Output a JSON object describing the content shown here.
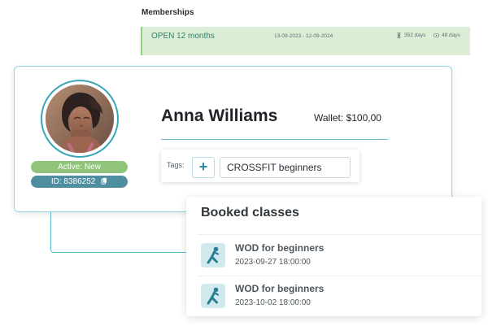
{
  "memberships": {
    "title": "Memberships",
    "item": {
      "name": "OPEN 12 months",
      "dates": "13-09-2023 - 12-09-2024",
      "days_label": "352 days",
      "remaining_label": "48 days"
    }
  },
  "profile": {
    "name": "Anna Williams",
    "wallet": "Wallet: $100,00",
    "status": "Active: New",
    "id_label": "ID: 8386252",
    "avatar_icon": "user-avatar-photo"
  },
  "tags": {
    "label": "Tags:",
    "add_label": "+",
    "value": "CROSSFIT beginners"
  },
  "booked_classes": {
    "title": "Booked classes",
    "items": [
      {
        "name": "WOD for beginners",
        "time": "2023-09-27 18:00:00",
        "icon": "exercise-stretch-icon"
      },
      {
        "name": "WOD for beginners",
        "time": "2023-10-02 18:00:00",
        "icon": "exercise-stretch-icon"
      }
    ]
  },
  "colors": {
    "accent_teal": "#3aa7b7",
    "membership_bg": "#dcefd6",
    "membership_border": "#8ccf7e",
    "status_green": "#8fc47a",
    "id_blue": "#4f8ea1",
    "icon_box": "#cfe9ef"
  }
}
